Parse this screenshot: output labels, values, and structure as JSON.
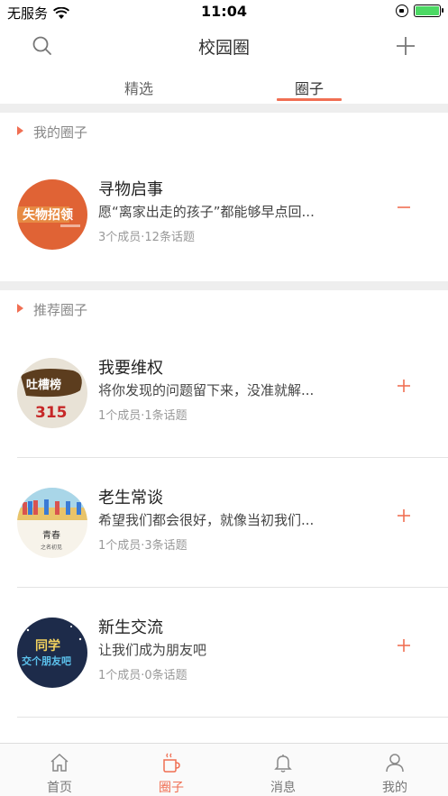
{
  "status_bar": {
    "carrier": "无服务",
    "time": "11:04"
  },
  "nav": {
    "title": "校园圈"
  },
  "tabs": [
    {
      "label": "精选"
    },
    {
      "label": "圈子"
    }
  ],
  "my_circles": {
    "header": "我的圈子",
    "items": [
      {
        "name": "寻物启事",
        "desc": "愿“离家出走的孩子”都能够早点回...",
        "meta": "3个成员·12条话题",
        "avatar_text": "失物招领",
        "action": "−"
      }
    ]
  },
  "recommended": {
    "header": "推荐圈子",
    "items": [
      {
        "name": "我要维权",
        "desc": "将你发现的问题留下来，没准就解...",
        "meta": "1个成员·1条话题",
        "avatar_text": "吐槽榜",
        "avatar_sub": "315",
        "action": "+"
      },
      {
        "name": "老生常谈",
        "desc": "希望我们都会很好，就像当初我们...",
        "meta": "1个成员·3条话题",
        "avatar_text": "青春",
        "avatar_sub": "之名初见",
        "action": "+"
      },
      {
        "name": "新生交流",
        "desc": "让我们成为朋友吧",
        "meta": "1个成员·0条话题",
        "avatar_text": "同学",
        "avatar_sub": "交个朋友吧",
        "action": "+"
      }
    ]
  },
  "tab_bar": [
    {
      "label": "首页",
      "icon": "home-icon"
    },
    {
      "label": "圈子",
      "icon": "cup-icon"
    },
    {
      "label": "消息",
      "icon": "bell-icon"
    },
    {
      "label": "我的",
      "icon": "user-icon"
    }
  ],
  "colors": {
    "accent": "#f06f53",
    "divider": "#eeeeee"
  }
}
